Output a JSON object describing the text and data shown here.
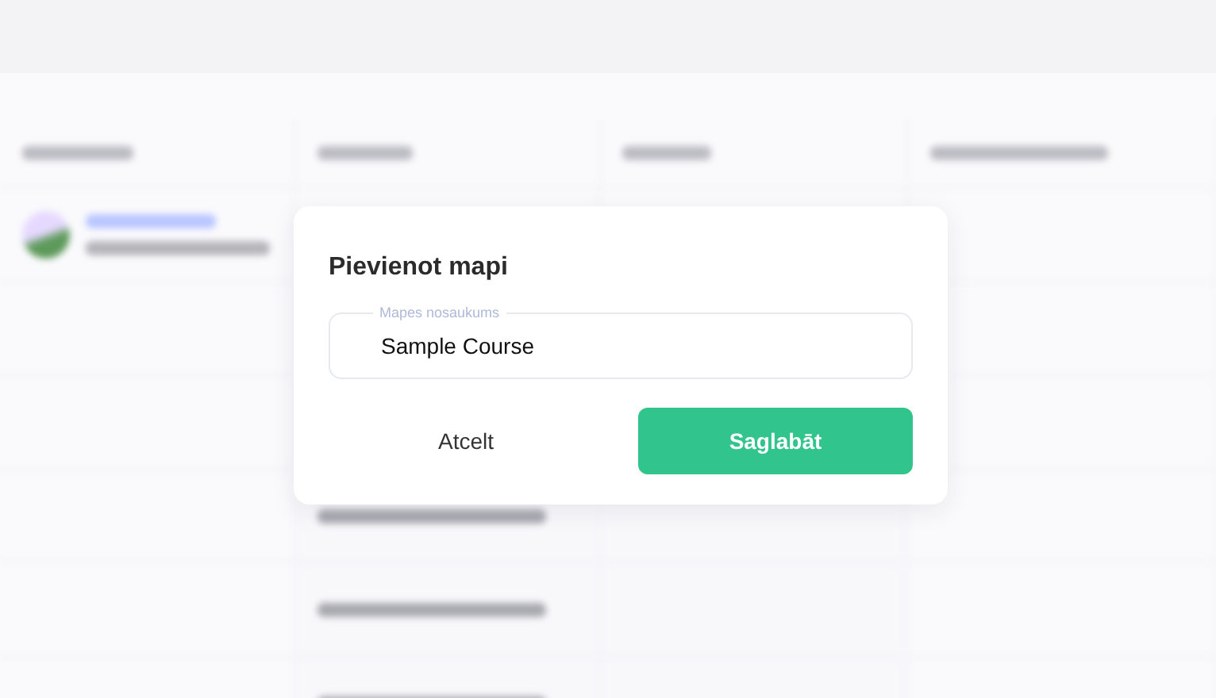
{
  "dialog": {
    "title": "Pievienot mapi",
    "field": {
      "label": "Mapes nosaukums",
      "value": "Sample Course"
    },
    "buttons": [
      {
        "kind": "cancel",
        "label": "Atcelt"
      },
      {
        "kind": "primary",
        "label": "Saglabāt"
      }
    ]
  }
}
